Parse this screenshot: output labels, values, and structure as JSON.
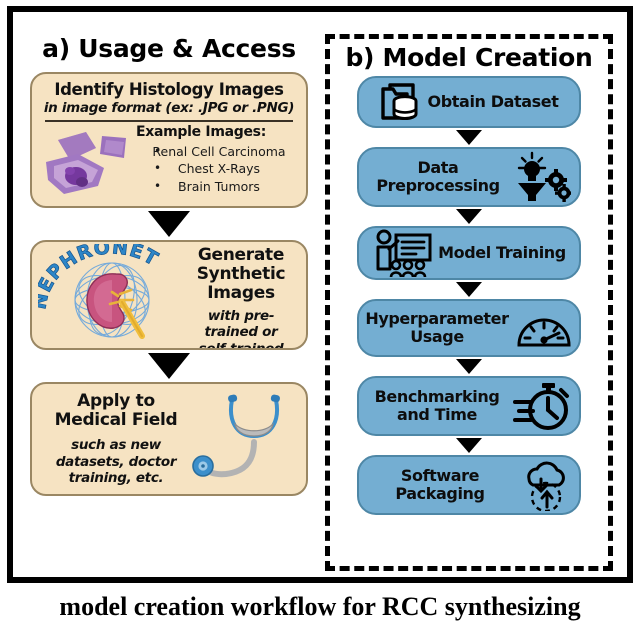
{
  "figure": {
    "caption": "model creation workflow for RCC synthesizing"
  },
  "panel_a": {
    "title": "a) Usage & Access",
    "steps": [
      {
        "id": "identify-histology-images",
        "heading": "Identify Histology Images",
        "subheading": "in image format (ex: .JPG or .PNG)",
        "example_title": "Example Images:",
        "examples": [
          "Renal Cell Carcinoma",
          "Chest X-Rays",
          "Brain Tumors"
        ],
        "image_alt": "histology-slide-thumbnail"
      },
      {
        "id": "generate-synthetic-images",
        "heading": "Generate\nSynthetic\nImages",
        "subheading": "with pre-trained or\nself-trained model",
        "logo_text": "NEPHRONET",
        "image_alt": "nephronet-kidney-logo"
      },
      {
        "id": "apply-to-medical-field",
        "heading": "Apply to\nMedical Field",
        "subheading": "such as new\ndatasets, doctor\ntraining, etc.",
        "image_alt": "stethoscope-illustration"
      }
    ]
  },
  "panel_b": {
    "title": "b) Model Creation",
    "steps": [
      {
        "id": "obtain-dataset",
        "label": "Obtain Dataset",
        "icon": "folder-database-icon",
        "icon_side": "left"
      },
      {
        "id": "data-preprocessing",
        "label": "Data\nPreprocessing",
        "icon": "lightbulb-funnel-gears-icon",
        "icon_side": "right"
      },
      {
        "id": "model-training",
        "label": "Model Training",
        "icon": "presenter-audience-icon",
        "icon_side": "left"
      },
      {
        "id": "hyperparameter-usage",
        "label": "Hyperparameter\nUsage",
        "icon": "gauge-icon",
        "icon_side": "right"
      },
      {
        "id": "benchmarking-and-time",
        "label": "Benchmarking\nand Time",
        "icon": "stopwatch-icon",
        "icon_side": "right"
      },
      {
        "id": "software-packaging",
        "label": "Software\nPackaging",
        "icon": "cloud-deploy-icon",
        "icon_side": "right"
      }
    ]
  },
  "colors": {
    "tan_card": "#F6E3C2",
    "blue_card": "#74AED2",
    "frame": "#000000",
    "logo_blue": "#2D86C8",
    "kidney_pink": "#C8547F",
    "histology_purple": "#7B4F9E"
  }
}
